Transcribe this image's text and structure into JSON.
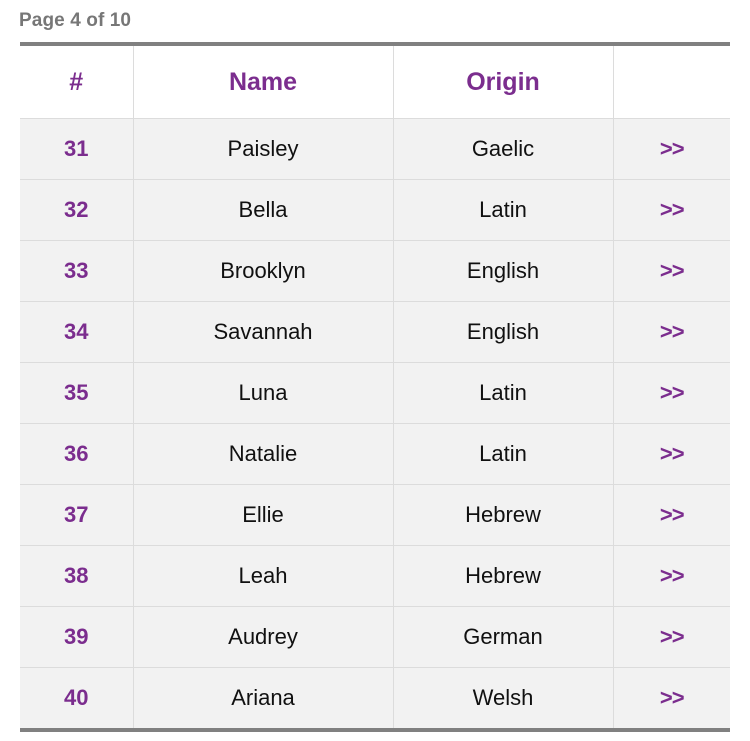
{
  "pagination": {
    "label": "Page 4 of 10",
    "current_page": 4,
    "total_pages": 10
  },
  "colors": {
    "accent_purple": "#7b2d8e",
    "heading_gray": "#777777",
    "row_background": "#f2f2f2",
    "cell_border": "#dcdcdc",
    "table_edge": "#808080"
  },
  "table": {
    "columns": [
      {
        "key": "num",
        "label": "#"
      },
      {
        "key": "name",
        "label": "Name"
      },
      {
        "key": "origin",
        "label": "Origin"
      },
      {
        "key": "action",
        "label": ""
      }
    ],
    "action_label": ">>",
    "action_icon": "double-chevron-right-icon",
    "rows": [
      {
        "num": "31",
        "name": "Paisley",
        "origin": "Gaelic",
        "action": ">>"
      },
      {
        "num": "32",
        "name": "Bella",
        "origin": "Latin",
        "action": ">>"
      },
      {
        "num": "33",
        "name": "Brooklyn",
        "origin": "English",
        "action": ">>"
      },
      {
        "num": "34",
        "name": "Savannah",
        "origin": "English",
        "action": ">>"
      },
      {
        "num": "35",
        "name": "Luna",
        "origin": "Latin",
        "action": ">>"
      },
      {
        "num": "36",
        "name": "Natalie",
        "origin": "Latin",
        "action": ">>"
      },
      {
        "num": "37",
        "name": "Ellie",
        "origin": "Hebrew",
        "action": ">>"
      },
      {
        "num": "38",
        "name": "Leah",
        "origin": "Hebrew",
        "action": ">>"
      },
      {
        "num": "39",
        "name": "Audrey",
        "origin": "German",
        "action": ">>"
      },
      {
        "num": "40",
        "name": "Ariana",
        "origin": "Welsh",
        "action": ">>"
      }
    ]
  }
}
